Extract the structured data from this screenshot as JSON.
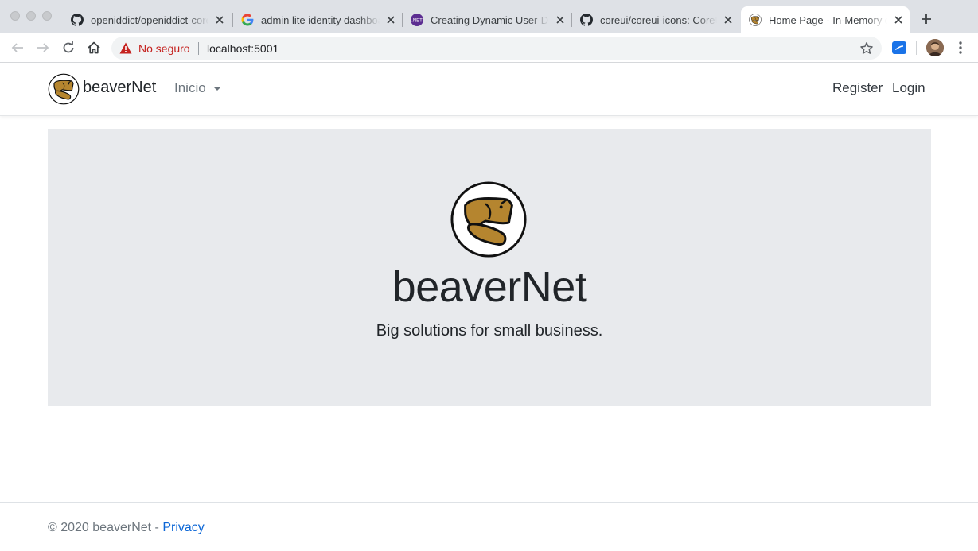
{
  "browser": {
    "tabs": [
      {
        "title": "openiddict/openiddict-core",
        "icon": "github-icon"
      },
      {
        "title": "admin lite identity dashboard",
        "icon": "google-icon"
      },
      {
        "title": "Creating Dynamic User-Defined",
        "icon": "dotnet-icon"
      },
      {
        "title": "coreui/coreui-icons: CoreUI",
        "icon": "github-icon"
      },
      {
        "title": "Home Page - In-Memory demo",
        "icon": "beaver-icon"
      }
    ],
    "security_label": "No seguro",
    "url": "localhost:5001"
  },
  "navbar": {
    "brand": "beaverNet",
    "dropdown_label": "Inicio",
    "register": "Register",
    "login": "Login"
  },
  "hero": {
    "title": "beaverNet",
    "lead": "Big solutions for small business."
  },
  "footer": {
    "copyright": "© 2020 beaverNet - ",
    "privacy": "Privacy"
  },
  "colors": {
    "beaver": "#b5852f",
    "jumbotron": "#e8eaed",
    "link": "#0b66d6",
    "warning": "#c5221f"
  }
}
